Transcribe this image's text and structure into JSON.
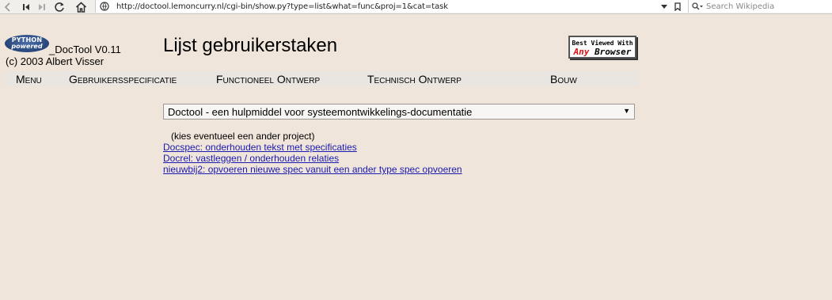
{
  "browser": {
    "url": "http://doctool.lemoncurry.nl/cgi-bin/show.py?type=list&what=func&proj=1&cat=task",
    "search_placeholder": "Search Wikipedia",
    "icons": [
      "back-icon",
      "first-icon",
      "last-icon",
      "reload-icon",
      "home-icon",
      "site-info-icon",
      "dropdown-icon",
      "bookmark-icon",
      "search-icon"
    ]
  },
  "header": {
    "logo_text_1": "PYTHON",
    "logo_text_2": "powered",
    "app_name": "_DocTool V0.11",
    "copyright": "(c) 2003 Albert Visser",
    "title": "Lijst gebruikerstaken",
    "badge_top": "Best Viewed With",
    "badge_any": "Any",
    "badge_browser": "Browser"
  },
  "nav": {
    "items": [
      "Menu",
      "Gebruikersspecificatie",
      "Functioneel Ontwerp",
      "Technisch Ontwerp",
      "Bouw"
    ]
  },
  "project": {
    "selected": "Doctool - een hulpmiddel voor systeemontwikkelings-documentatie",
    "hint": "(kies eventueel een ander project)"
  },
  "links": [
    "Docspec: onderhouden tekst met specificaties",
    "Docrel: vastleggen / onderhouden relaties",
    "nieuwbij2: opvoeren nieuwe spec vanuit een ander type spec opvoeren"
  ],
  "colors": {
    "page_bg": "#efe5da",
    "link": "#1a1ab0",
    "nav_bg": "#e9e6e2"
  }
}
